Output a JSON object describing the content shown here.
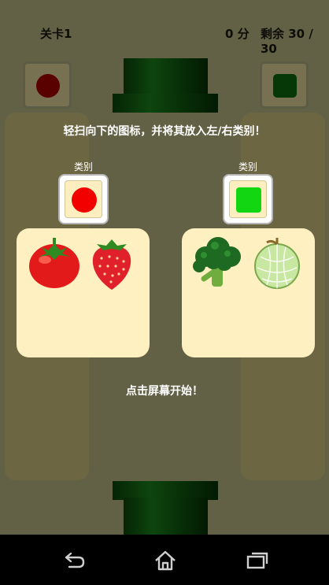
{
  "hud": {
    "level": "关卡1",
    "score": "0 分",
    "remaining": "剩余 30 / 30"
  },
  "tutorial": {
    "instruction": "轻扫向下的图标，并将其放入左/右类别！",
    "left_category": {
      "label": "类别",
      "color": "#f20000",
      "shape": "circle",
      "examples": [
        "tomato-icon",
        "strawberry-icon"
      ]
    },
    "right_category": {
      "label": "类别",
      "color": "#12d612",
      "shape": "square",
      "examples": [
        "broccoli-icon",
        "melon-icon"
      ]
    },
    "start_prompt": "点击屏幕开始！"
  },
  "colors": {
    "pipe": "#1c8a1c",
    "column": "#d8cd86",
    "panel": "#fff0c2",
    "left_corner_marker": "#b20000",
    "right_corner_marker": "#0c6e0c"
  },
  "navbar": {
    "icons": [
      "back-icon",
      "home-icon",
      "recent-apps-icon"
    ]
  }
}
